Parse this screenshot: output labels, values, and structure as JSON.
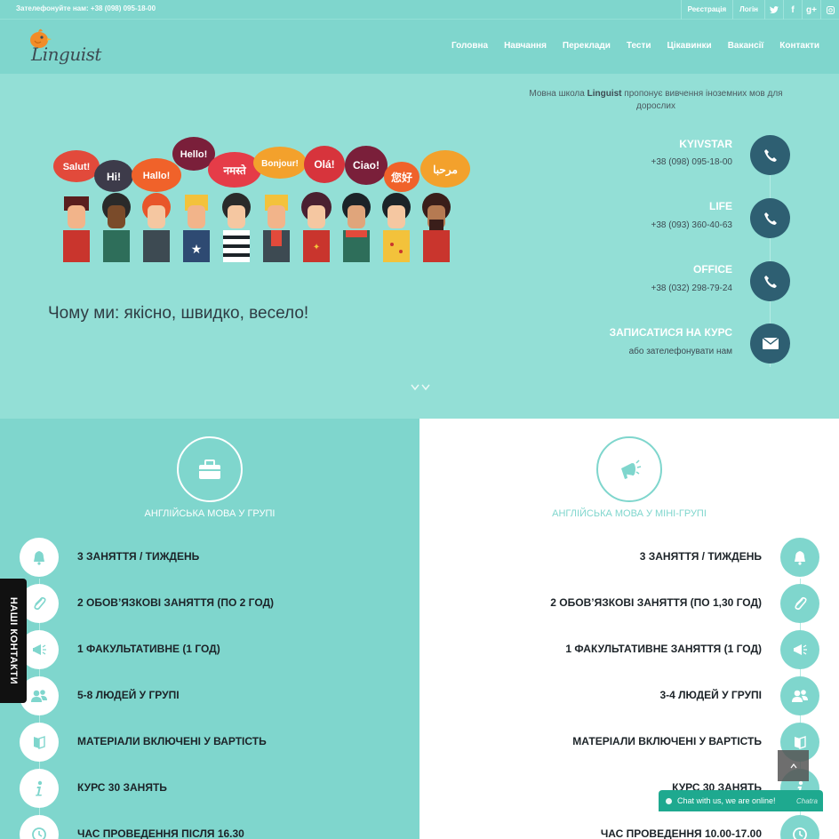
{
  "topbar": {
    "phone": "Зателефонуйте нам: +38 (098) 095-18-00",
    "register": "Реєстрація",
    "login": "Логін",
    "social": [
      "twitter-icon",
      "facebook-icon",
      "google-plus-icon",
      "instagram-icon"
    ]
  },
  "header": {
    "logo_text": "Linguist",
    "nav": [
      "Головна",
      "Навчання",
      "Переклади",
      "Тести",
      "Цікавинки",
      "Вакансії",
      "Контакти"
    ]
  },
  "hero": {
    "intro_pre": "Мовна школа ",
    "intro_brand": "Linguist",
    "intro_post": " пропонує вивчення іноземних мов для дорослих",
    "bubbles": [
      "Salut!",
      "Hi!",
      "Hallo!",
      "Hello!",
      "नमस्ते",
      "Bonjour!",
      "Olá!",
      "Ciao!",
      "您好",
      "مرحبا"
    ],
    "tagline": "Чому ми: якісно, швидко, весело!",
    "contacts": [
      {
        "label": "KYIVSTAR",
        "sub": "+38 (098) 095-18-00",
        "icon": "phone-icon"
      },
      {
        "label": "LIFE",
        "sub": "+38 (093) 360-40-63",
        "icon": "phone-icon"
      },
      {
        "label": "OFFICE",
        "sub": "+38 (032) 298-79-24",
        "icon": "phone-icon"
      },
      {
        "label": "ЗАПИСАТИСЯ НА КУРС",
        "sub": "або зателефонувати нам",
        "icon": "envelope-icon"
      }
    ]
  },
  "left_panel": {
    "title": "АНГЛІЙСЬКА МОВА У ГРУПІ",
    "features": [
      {
        "text": "3 ЗАНЯТТЯ / ТИЖДЕНЬ",
        "icon": "bell-icon"
      },
      {
        "text": "2 ОБОВ’ЯЗКОВІ ЗАНЯТТЯ (ПО 2 ГОД)",
        "icon": "paperclip-icon"
      },
      {
        "text": "1 ФАКУЛЬТАТИВНЕ (1 ГОД)",
        "icon": "megaphone-icon"
      },
      {
        "text": "5-8 ЛЮДЕЙ У ГРУПІ",
        "icon": "users-icon"
      },
      {
        "text": "МАТЕРІАЛИ ВКЛЮЧЕНІ У ВАРТІСТЬ",
        "icon": "book-icon"
      },
      {
        "text": "КУРС 30 ЗАНЯТЬ",
        "icon": "info-icon"
      },
      {
        "text": "ЧАС ПРОВЕДЕННЯ ПІСЛЯ 16.30",
        "icon": "clock-icon"
      }
    ]
  },
  "right_panel": {
    "title": "АНГЛІЙСЬКА МОВА У МІНІ-ГРУПІ",
    "features": [
      {
        "text": "3 ЗАНЯТТЯ / ТИЖДЕНЬ",
        "icon": "bell-icon"
      },
      {
        "text": "2 ОБОВ’ЯЗКОВІ ЗАНЯТТЯ (ПО 1,30 ГОД)",
        "icon": "paperclip-icon"
      },
      {
        "text": "1 ФАКУЛЬТАТИВНЕ ЗАНЯТТЯ (1 ГОД)",
        "icon": "megaphone-icon"
      },
      {
        "text": "3-4 ЛЮДЕЙ У ГРУПІ",
        "icon": "users-icon"
      },
      {
        "text": "МАТЕРІАЛИ ВКЛЮЧЕНІ У ВАРТІСТЬ",
        "icon": "book-icon"
      },
      {
        "text": "КУРС 30 ЗАНЯТЬ",
        "icon": "info-icon"
      },
      {
        "text": "ЧАС ПРОВЕДЕННЯ 10.00-17.00",
        "icon": "clock-icon"
      }
    ]
  },
  "side_tab": "НАШІ КОНТАКТИ",
  "chat": {
    "text": "Chat with us, we are online!",
    "brand": "Chatra"
  },
  "colors": {
    "accent": "#7fd6cd",
    "hero_bg": "#93dfd6",
    "dark_circle": "#2e5f72",
    "chat": "#1ea98f"
  }
}
